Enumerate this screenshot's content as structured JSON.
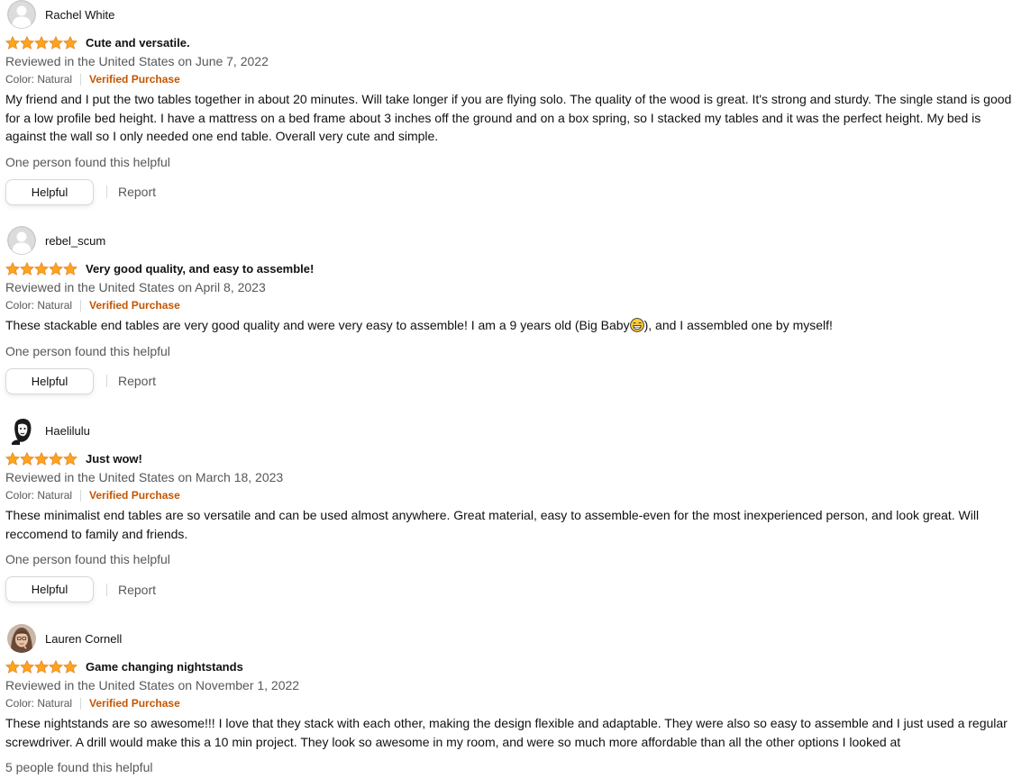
{
  "colors": {
    "star": "#ffa41c",
    "verified": "#c45500",
    "muted": "#565959",
    "text": "#0f1111"
  },
  "reviews": [
    {
      "profile_name": "Rachel White",
      "avatar": "default-avatar",
      "rating_stars": 5,
      "title": "Cute and versatile.",
      "date": "Reviewed in the United States on June 7, 2022",
      "format": "Color: Natural",
      "verified": "Verified Purchase",
      "body": "My friend and I put the two tables together in about 20 minutes. Will take longer if you are flying solo. The quality of the wood is great. It's strong and sturdy. The single stand is good for a low profile bed height. I have a mattress on a bed frame about 3 inches off the ground and on a box spring, so I stacked my tables and it was the perfect height. My bed is against the wall so I only needed one end table. Overall very cute and simple.",
      "helpful_count": "One person found this helpful",
      "helpful_label": "Helpful",
      "report_label": "Report"
    },
    {
      "profile_name": "rebel_scum",
      "avatar": "default-avatar",
      "rating_stars": 5,
      "title": "Very good quality, and easy to assemble!",
      "date": "Reviewed in the United States on April 8, 2023",
      "format": "Color: Natural",
      "verified": "Verified Purchase",
      "body_before_emoji": "These stackable end tables are very good quality and were very easy to assemble! I am a 9 years old (Big Baby",
      "body_after_emoji": "), and I assembled one by myself!",
      "helpful_count": "One person found this helpful",
      "helpful_label": "Helpful",
      "report_label": "Report"
    },
    {
      "profile_name": "Haelilulu",
      "avatar": "sketch-portrait-avatar",
      "rating_stars": 5,
      "title": "Just wow!",
      "date": "Reviewed in the United States on March 18, 2023",
      "format": "Color: Natural",
      "verified": "Verified Purchase",
      "body": "These minimalist end tables are so versatile and can be used almost anywhere. Great material, easy to assemble-even for the most inexperienced person, and look great. Will reccomend to family and friends.",
      "helpful_count": "One person found this helpful",
      "helpful_label": "Helpful",
      "report_label": "Report"
    },
    {
      "profile_name": "Lauren Cornell",
      "avatar": "photo-avatar",
      "rating_stars": 5,
      "title": "Game changing nightstands",
      "date": "Reviewed in the United States on November 1, 2022",
      "format": "Color: Natural",
      "verified": "Verified Purchase",
      "body": "These nightstands are so awesome!!! I love that they stack with each other, making the design flexible and adaptable. They were also so easy to assemble and I just used a regular screwdriver. A drill would make this a 10 min project. They look so awesome in my room, and were so much more affordable than all the other options I looked at",
      "helpful_count": "5 people found this helpful"
    }
  ]
}
